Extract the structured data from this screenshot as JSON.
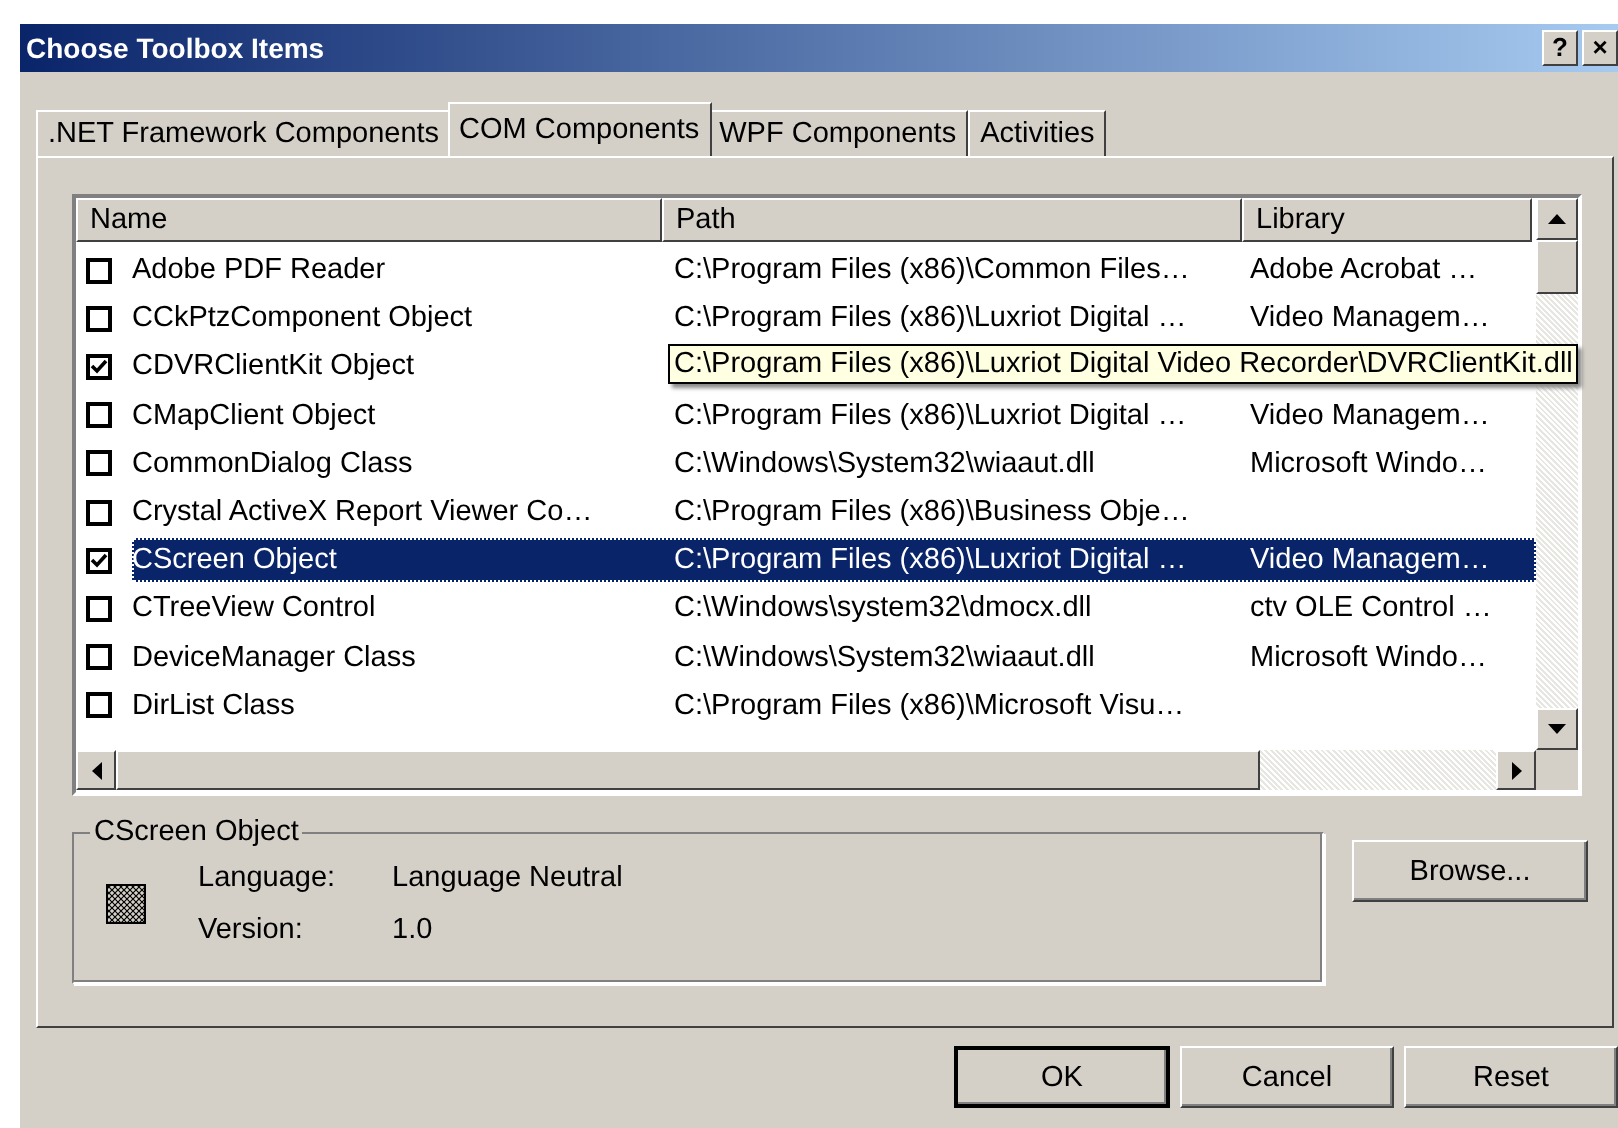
{
  "window": {
    "title": "Choose Toolbox Items",
    "title_buttons": [
      "?",
      "×"
    ]
  },
  "tabs": [
    {
      "label": ".NET Framework Components",
      "selected": false
    },
    {
      "label": "COM Components",
      "selected": true
    },
    {
      "label": "WPF Components",
      "selected": false
    },
    {
      "label": "Activities",
      "selected": false
    }
  ],
  "list": {
    "columns": [
      "Name",
      "Path",
      "Library"
    ],
    "rows": [
      {
        "name": "Adobe PDF Reader",
        "checked": false,
        "selected": false,
        "path": "C:\\Program Files (x86)\\Common Files…",
        "library": "Adobe Acrobat …"
      },
      {
        "name": "CCkPtzComponent Object",
        "checked": false,
        "selected": false,
        "path": "C:\\Program Files (x86)\\Luxriot Digital …",
        "library": "Video Managem…"
      },
      {
        "name": "CDVRClientKit Object",
        "checked": true,
        "selected": false,
        "tooltip": "C:\\Program Files (x86)\\Luxriot Digital Video Recorder\\DVRClientKit.dll"
      },
      {
        "name": "CMapClient Object",
        "checked": false,
        "selected": false,
        "path": "C:\\Program Files (x86)\\Luxriot Digital …",
        "library": "Video Managem…"
      },
      {
        "name": "CommonDialog Class",
        "checked": false,
        "selected": false,
        "path": "C:\\Windows\\System32\\wiaaut.dll",
        "library": "Microsoft Windo…"
      },
      {
        "name": "Crystal ActiveX Report Viewer Co…",
        "checked": false,
        "selected": false,
        "path": "C:\\Program Files (x86)\\Business Obje…"
      },
      {
        "name": "CScreen Object",
        "checked": true,
        "selected": true,
        "path": "C:\\Program Files (x86)\\Luxriot Digital …",
        "library": "Video Managem…"
      },
      {
        "name": "CTreeView Control",
        "checked": false,
        "selected": false,
        "path": "C:\\Windows\\system32\\dmocx.dll",
        "library": "ctv OLE Control …"
      },
      {
        "name": "DeviceManager Class",
        "checked": false,
        "selected": false,
        "path": "C:\\Windows\\System32\\wiaaut.dll",
        "library": "Microsoft Windo…"
      },
      {
        "name": "DirList Class",
        "checked": false,
        "selected": false,
        "path": "C:\\Program Files (x86)\\Microsoft Visu…"
      }
    ]
  },
  "details": {
    "title": "CScreen Object",
    "language_label": "Language:",
    "language": "Language Neutral",
    "version_label": "Version:",
    "version": "1.0"
  },
  "buttons": {
    "browse": "Browse...",
    "ok": "OK",
    "cancel": "Cancel",
    "reset": "Reset"
  }
}
